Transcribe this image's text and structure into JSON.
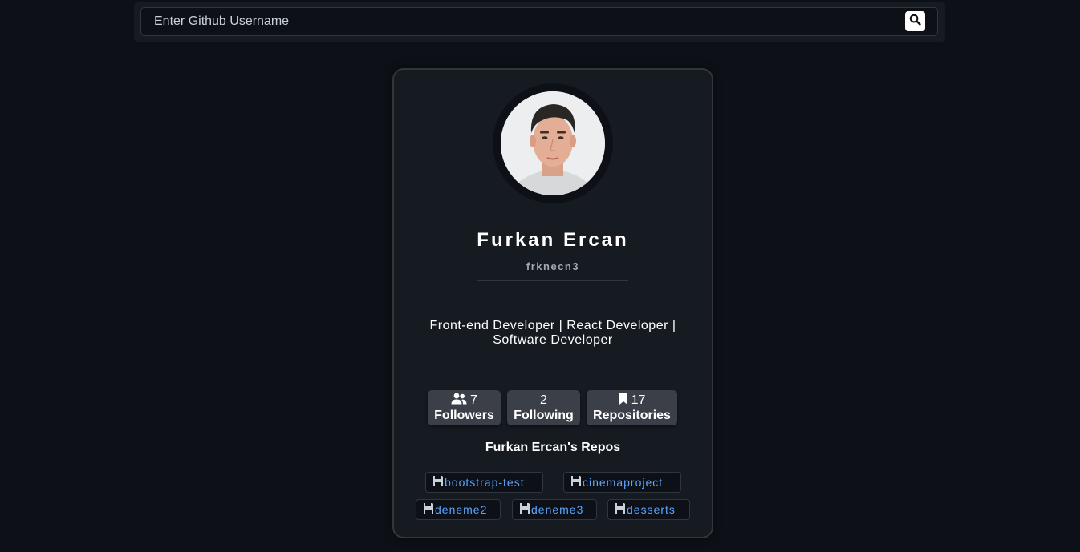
{
  "search": {
    "placeholder": "Enter Github Username",
    "value": ""
  },
  "profile": {
    "name": "Furkan Ercan",
    "login": "frknecn3",
    "bio": "Front-end Developer | React Developer | Software Developer",
    "stats": [
      {
        "value": "7",
        "label": "Followers",
        "icon": "users-icon"
      },
      {
        "value": "2",
        "label": "Following",
        "icon": ""
      },
      {
        "value": "17",
        "label": "Repositories",
        "icon": "bookmark-icon"
      }
    ]
  },
  "repos": {
    "title": "Furkan Ercan's Repos",
    "items": [
      "bootstrap-test",
      "cinemaproject",
      "deneme2",
      "deneme3",
      "desserts"
    ]
  },
  "colors": {
    "background": "#0d1117",
    "card": "#161b22",
    "stat_box": "#3b3f47",
    "link": "#58a6ff"
  }
}
